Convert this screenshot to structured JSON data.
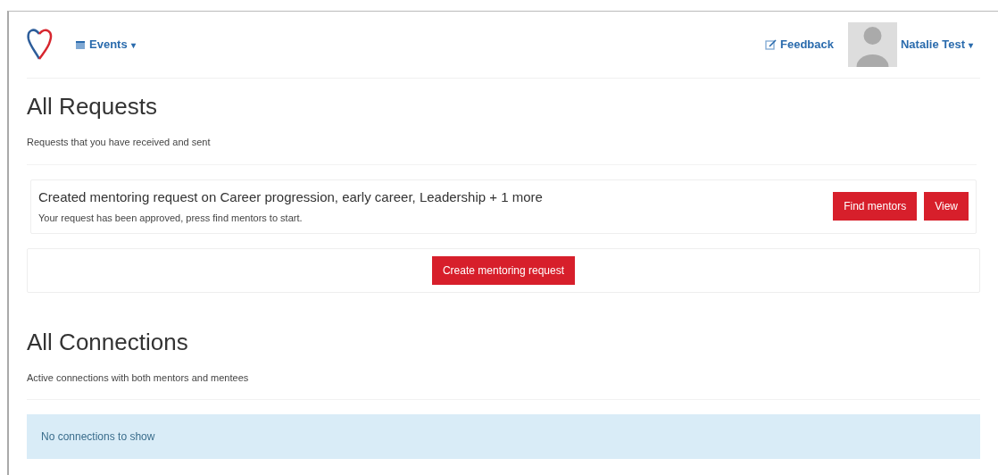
{
  "navbar": {
    "menu": {
      "label": "Events",
      "caret": "▾"
    },
    "feedback": {
      "label": "Feedback"
    },
    "user": {
      "name": "Natalie Test",
      "caret": "▾"
    }
  },
  "requests_section": {
    "title": "All Requests",
    "subtitle": "Requests that you have received and sent",
    "requests": [
      {
        "title": "Created mentoring request on Career progression, early career, Leadership + 1 more",
        "status": "Your request has been approved, press find mentors to start.",
        "actions": [
          "Find mentors",
          "View"
        ]
      }
    ],
    "create_button": "Create mentoring request"
  },
  "connections_section": {
    "title": "All Connections",
    "subtitle": "Active connections with both mentors and mentees",
    "empty_message": "No connections to show"
  }
}
